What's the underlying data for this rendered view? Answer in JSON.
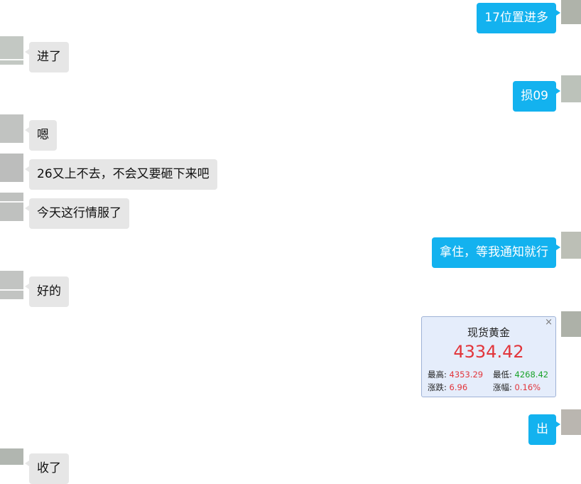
{
  "messages": [
    {
      "side": "out",
      "text": "17位置进多"
    },
    {
      "side": "in",
      "text": "进了"
    },
    {
      "side": "out",
      "text": "损09"
    },
    {
      "side": "in",
      "text": "嗯"
    },
    {
      "side": "in",
      "text": "26又上不去，不会又要砸下来吧"
    },
    {
      "side": "in",
      "text": "今天这行情服了"
    },
    {
      "side": "out",
      "text": "拿住，等我通知就行"
    },
    {
      "side": "in",
      "text": "好的"
    },
    {
      "side": "out",
      "text": "出"
    },
    {
      "side": "in",
      "text": "收了"
    }
  ],
  "quote_card": {
    "title": "现货黄金",
    "price": "4334.42",
    "high_label": "最高:",
    "high_value": "4353.29",
    "low_label": "最低:",
    "low_value": "4268.42",
    "change_label": "涨跌:",
    "change_value": "6.96",
    "pct_label": "涨幅:",
    "pct_value": "0.16%",
    "close_icon": "×",
    "colors": {
      "up": "#e2353b",
      "down": "#1aa32a",
      "background": "#e5edfb"
    }
  },
  "colors": {
    "outgoing": "#13b2ef",
    "incoming": "#e6e6e6"
  }
}
